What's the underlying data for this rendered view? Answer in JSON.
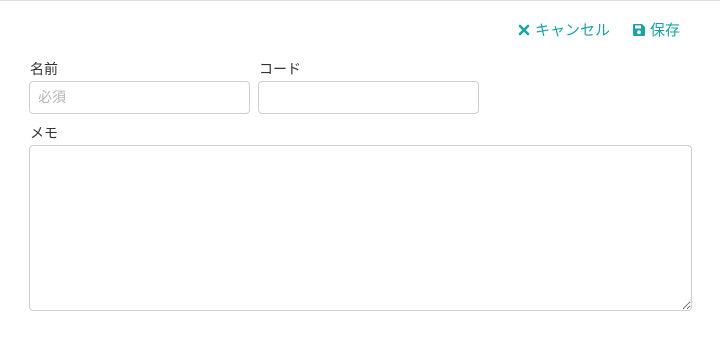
{
  "toolbar": {
    "cancel_label": "キャンセル",
    "cancel_icon": "close-icon",
    "save_label": "保存",
    "save_icon": "floppy-disk-icon",
    "accent_color": "#1aa3a3"
  },
  "form": {
    "name": {
      "label": "名前",
      "value": "",
      "placeholder": "必須"
    },
    "code": {
      "label": "コード",
      "value": "",
      "placeholder": ""
    },
    "memo": {
      "label": "メモ",
      "value": ""
    }
  }
}
